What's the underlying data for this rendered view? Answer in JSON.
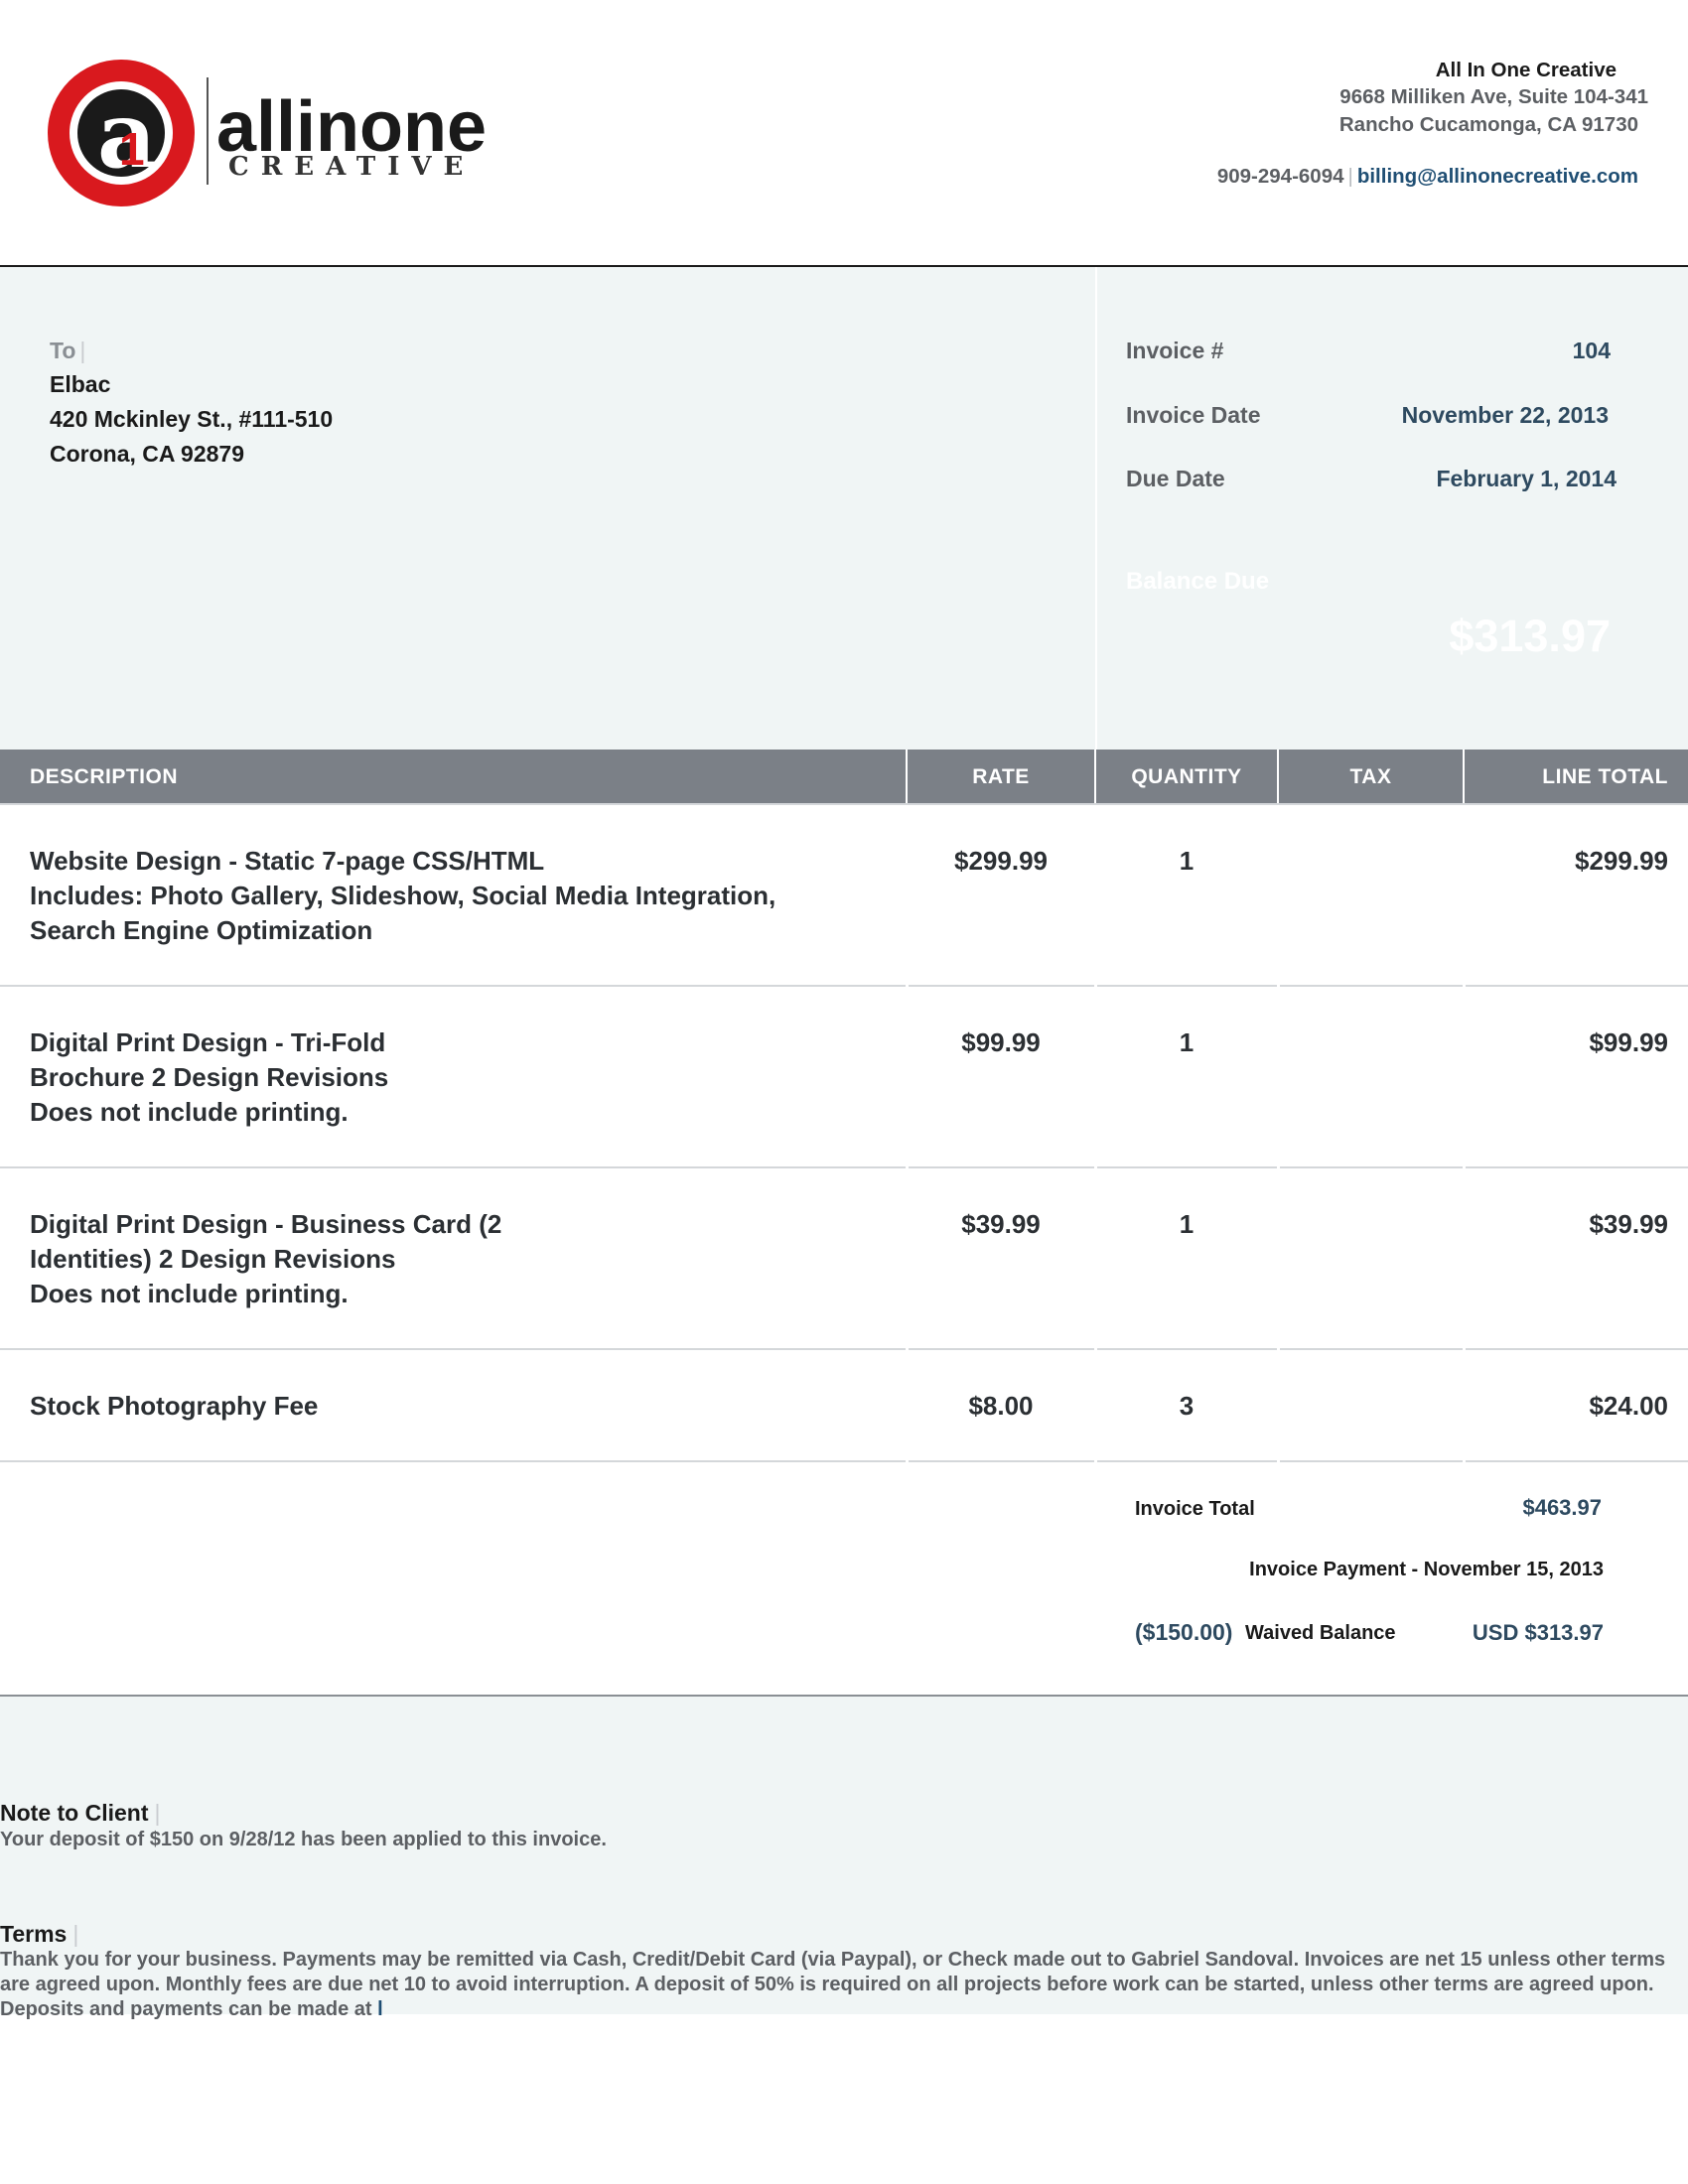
{
  "company": {
    "logo_word": "allinone",
    "logo_sub": "CREATIVE",
    "logo_letter": "a",
    "logo_number": "1",
    "name": "All In One Creative",
    "address_line1": "9668 Milliken Ave, Suite 104-341",
    "address_line2": "Rancho Cucamonga, CA 91730",
    "phone": "909-294-6094",
    "separator": "|",
    "email": "billing@allinonecreative.com",
    "brand_color": "#d9191e"
  },
  "client": {
    "label": "To",
    "separator": "|",
    "name": "Elbac",
    "address_line1": "420 Mckinley St., #111-510",
    "address_line2": "Corona, CA 92879"
  },
  "invoice": {
    "number_label": "Invoice #",
    "number": "104",
    "date_label": "Invoice Date",
    "date": "November 22, 2013",
    "due_label": "Due Date",
    "due_date": "February 1, 2014",
    "balance_label": "Balance Due",
    "balance": "$313.97"
  },
  "table": {
    "headers": {
      "description": "DESCRIPTION",
      "rate": "RATE",
      "quantity": "QUANTITY",
      "tax": "TAX",
      "line_total": "LINE TOTAL"
    },
    "header_color": "#7b8087",
    "rows": [
      {
        "description": [
          "Website Design - Static 7-page CSS/HTML",
          "Includes: Photo Gallery, Slideshow, Social Media Integration,",
          "Search Engine Optimization"
        ],
        "rate": "$299.99",
        "quantity": "1",
        "tax": "",
        "total": "$299.99"
      },
      {
        "description": [
          "Digital Print Design - Tri-Fold",
          "Brochure 2 Design Revisions",
          "Does not include printing."
        ],
        "rate": "$99.99",
        "quantity": "1",
        "tax": "",
        "total": "$99.99"
      },
      {
        "description": [
          "Digital Print Design - Business Card (2",
          "Identities) 2 Design Revisions",
          "Does not include printing."
        ],
        "rate": "$39.99",
        "quantity": "1",
        "tax": "",
        "total": "$39.99"
      },
      {
        "description": [
          "Stock Photography Fee"
        ],
        "rate": "$8.00",
        "quantity": "3",
        "tax": "",
        "total": "$24.00"
      }
    ]
  },
  "totals": {
    "invoice_total_label": "Invoice Total",
    "invoice_total": "$463.97",
    "payment_line": "Invoice Payment - November 15, 2013",
    "waived_amount": "($150.00)",
    "waived_label": "Waived Balance",
    "balance": "USD $313.97"
  },
  "notes": {
    "note_label": "Note to Client",
    "note_text": "Your deposit of $150 on 9/28/12 has been applied to this invoice.",
    "terms_label": "Terms",
    "terms_text": "Thank you for your business. Payments may be remitted via Cash, Credit/Debit Card (via Paypal), or Check made out to Gabriel Sandoval. Invoices are net 15 unless other terms are agreed upon. Monthly fees are due net 10 to avoid interruption. A deposit of 50% is required on all projects before work can be started, unless other terms are agreed upon. Deposits and payments can be made at ",
    "terms_link": "l",
    "separator": "|"
  }
}
